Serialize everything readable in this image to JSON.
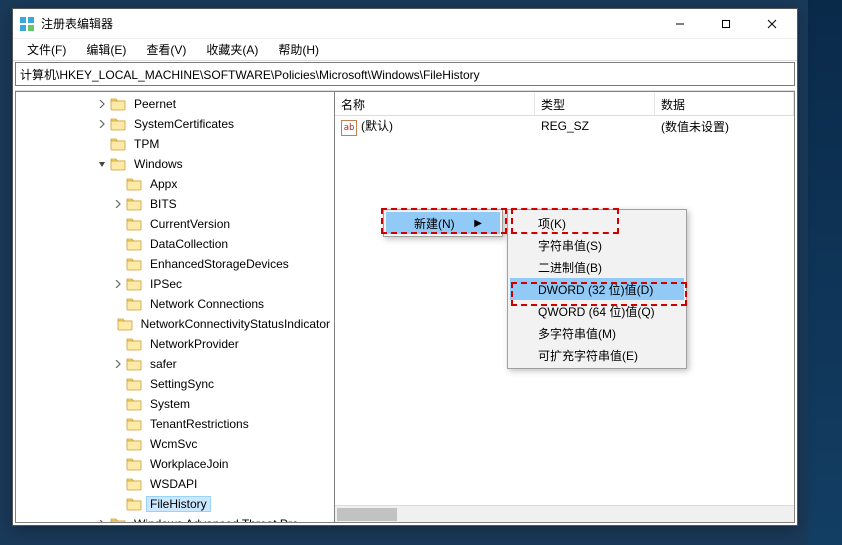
{
  "window": {
    "title": "注册表编辑器"
  },
  "menubar": {
    "items": [
      {
        "label": "文件(F)"
      },
      {
        "label": "编辑(E)"
      },
      {
        "label": "查看(V)"
      },
      {
        "label": "收藏夹(A)"
      },
      {
        "label": "帮助(H)"
      }
    ]
  },
  "addressbar": {
    "path": "计算机\\HKEY_LOCAL_MACHINE\\SOFTWARE\\Policies\\Microsoft\\Windows\\FileHistory"
  },
  "tree": {
    "items": [
      {
        "indent": 5,
        "expander": ">",
        "label": "Peernet"
      },
      {
        "indent": 5,
        "expander": ">",
        "label": "SystemCertificates"
      },
      {
        "indent": 5,
        "expander": "",
        "label": "TPM"
      },
      {
        "indent": 5,
        "expander": "v",
        "label": "Windows"
      },
      {
        "indent": 6,
        "expander": "",
        "label": "Appx"
      },
      {
        "indent": 6,
        "expander": ">",
        "label": "BITS"
      },
      {
        "indent": 6,
        "expander": "",
        "label": "CurrentVersion"
      },
      {
        "indent": 6,
        "expander": "",
        "label": "DataCollection"
      },
      {
        "indent": 6,
        "expander": "",
        "label": "EnhancedStorageDevices"
      },
      {
        "indent": 6,
        "expander": ">",
        "label": "IPSec"
      },
      {
        "indent": 6,
        "expander": "",
        "label": "Network Connections"
      },
      {
        "indent": 6,
        "expander": "",
        "label": "NetworkConnectivityStatusIndicator"
      },
      {
        "indent": 6,
        "expander": "",
        "label": "NetworkProvider"
      },
      {
        "indent": 6,
        "expander": ">",
        "label": "safer"
      },
      {
        "indent": 6,
        "expander": "",
        "label": "SettingSync"
      },
      {
        "indent": 6,
        "expander": "",
        "label": "System"
      },
      {
        "indent": 6,
        "expander": "",
        "label": "TenantRestrictions"
      },
      {
        "indent": 6,
        "expander": "",
        "label": "WcmSvc"
      },
      {
        "indent": 6,
        "expander": "",
        "label": "WorkplaceJoin"
      },
      {
        "indent": 6,
        "expander": "",
        "label": "WSDAPI"
      },
      {
        "indent": 6,
        "expander": "",
        "label": "FileHistory",
        "selected": true
      },
      {
        "indent": 5,
        "expander": ">",
        "label": "Windows Advanced Threat Pro..."
      }
    ]
  },
  "list": {
    "columns": {
      "name": "名称",
      "type": "类型",
      "data": "数据"
    },
    "rows": [
      {
        "name": "(默认)",
        "type": "REG_SZ",
        "data": "(数值未设置)"
      }
    ]
  },
  "context": {
    "parent": {
      "new_label": "新建(N)"
    },
    "sub_items": [
      {
        "label": "项(K)"
      },
      {
        "label": "字符串值(S)"
      },
      {
        "label": "二进制值(B)"
      },
      {
        "label": "DWORD (32 位)值(D)",
        "selected": true
      },
      {
        "label": "QWORD (64 位)值(Q)"
      },
      {
        "label": "多字符串值(M)"
      },
      {
        "label": "可扩充字符串值(E)"
      }
    ]
  }
}
